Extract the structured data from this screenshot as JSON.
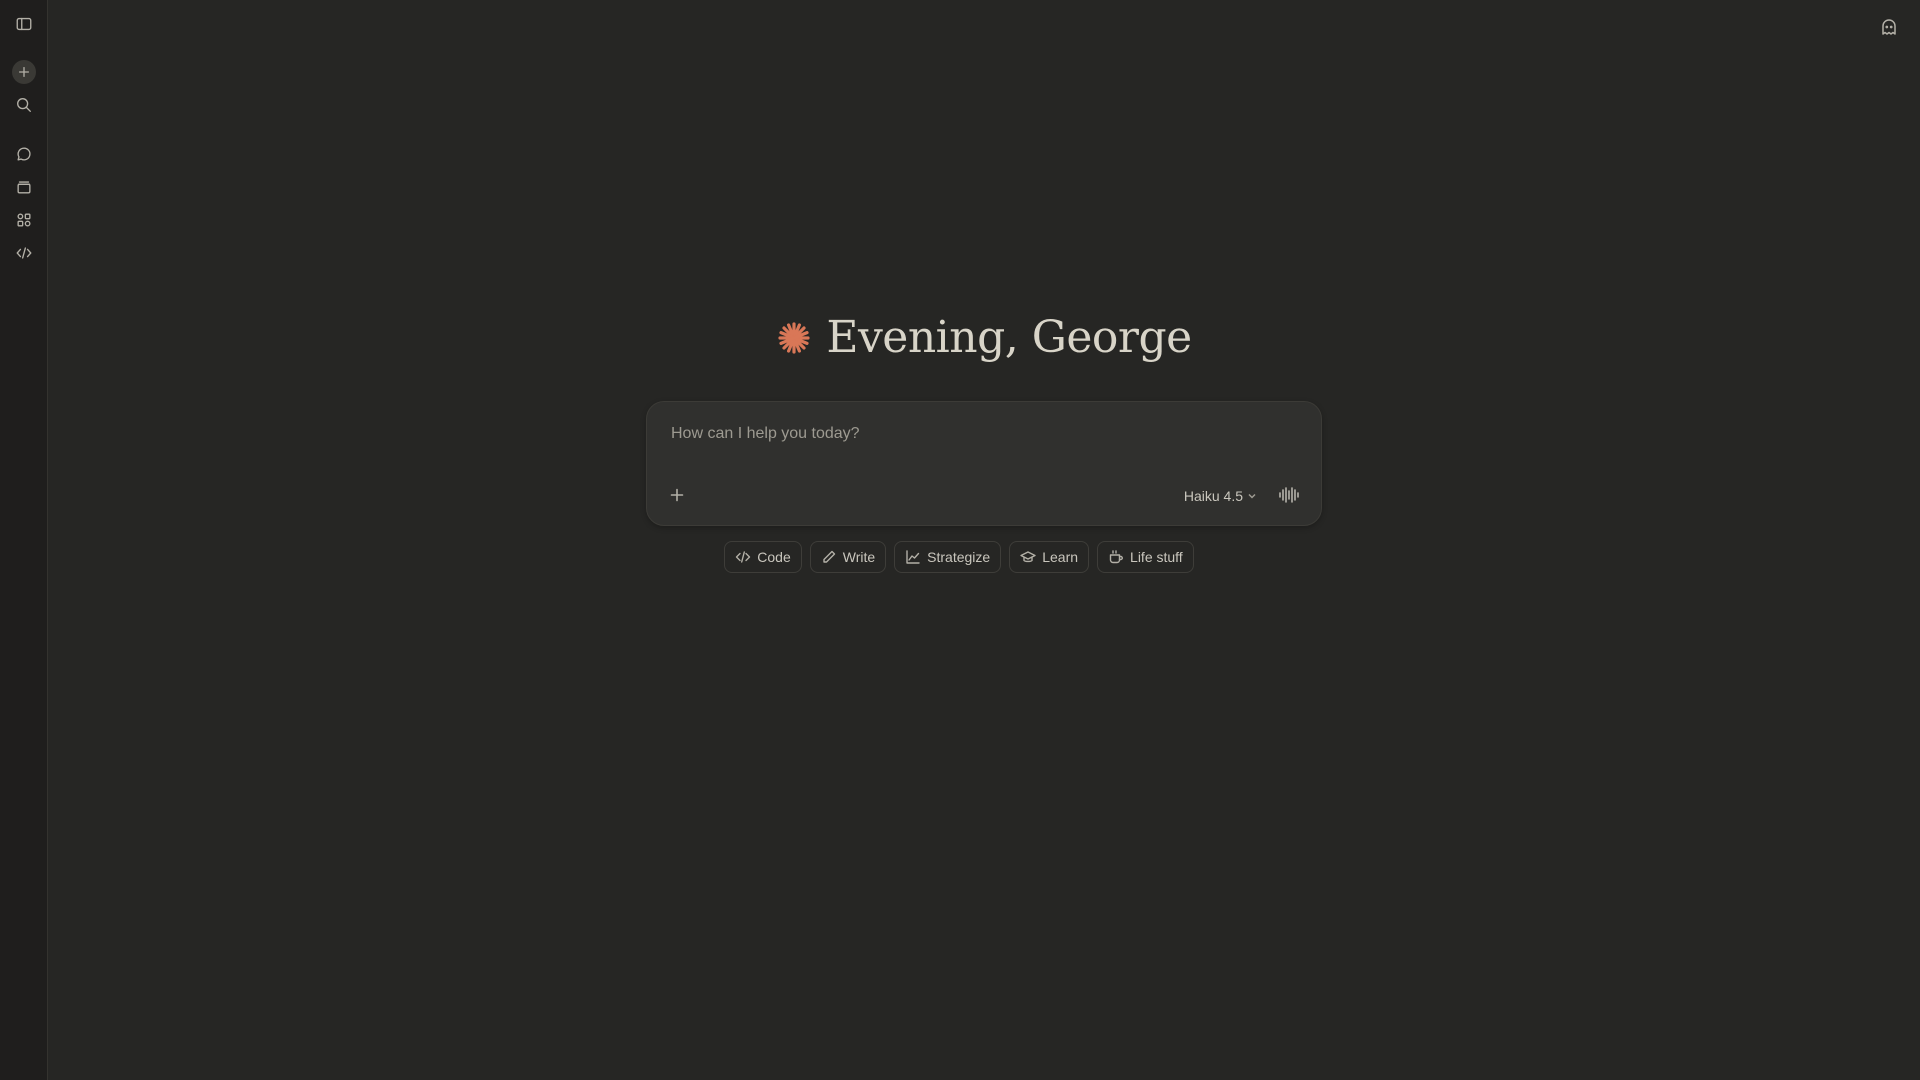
{
  "greeting": {
    "text": "Evening, George"
  },
  "composer": {
    "placeholder": "How can I help you today?",
    "model_label": "Haiku 4.5"
  },
  "chips": [
    {
      "label": "Code",
      "icon": "code-icon"
    },
    {
      "label": "Write",
      "icon": "pencil-icon"
    },
    {
      "label": "Strategize",
      "icon": "chart-line-icon"
    },
    {
      "label": "Learn",
      "icon": "graduation-cap-icon"
    },
    {
      "label": "Life stuff",
      "icon": "coffee-cup-icon"
    }
  ],
  "sidebar": {
    "items": [
      {
        "icon": "sidebar-toggle-icon"
      },
      {
        "icon": "plus-icon"
      },
      {
        "icon": "search-icon"
      },
      {
        "icon": "chat-bubble-icon"
      },
      {
        "icon": "projects-icon"
      },
      {
        "icon": "artifacts-icon"
      },
      {
        "icon": "code-icon"
      }
    ]
  },
  "header": {
    "icon": "ghost-icon"
  },
  "colors": {
    "background": "#262624",
    "sidebar": "#1f1e1d",
    "composer": "#30302e",
    "accent": "#d97757",
    "text": "#c9c6bd"
  }
}
